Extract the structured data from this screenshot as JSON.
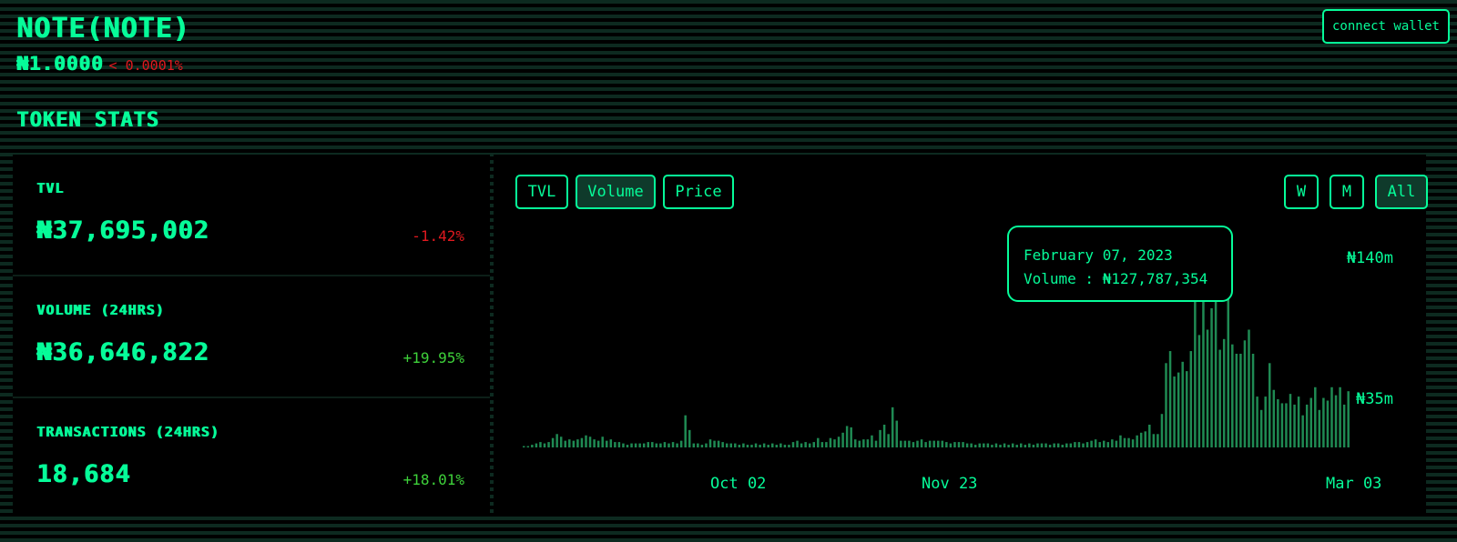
{
  "header": {
    "title": "NOTE(NOTE)",
    "price": "₦1.0000",
    "price_change": "< 0.0001%",
    "connect_label": "connect wallet"
  },
  "section_title": "TOKEN STATS",
  "stats": [
    {
      "label": "TVL",
      "value": "₦37,695,002",
      "change": "-1.42%"
    },
    {
      "label": "VOLUME (24HRS)",
      "value": "₦36,646,822",
      "change": "+19.95%"
    },
    {
      "label": "TRANSACTIONS (24HRS)",
      "value": "18,684",
      "change": "+18.01%"
    }
  ],
  "chart_controls": {
    "metric_tabs": [
      "TVL",
      "Volume",
      "Price"
    ],
    "active_metric": "Volume",
    "range_tabs": [
      "W",
      "M",
      "All"
    ],
    "active_range": "All"
  },
  "tooltip": {
    "date": "February 07, 2023",
    "value_line": "Volume : ₦127,787,354"
  },
  "colors": {
    "accent": "#06fc99",
    "bar": "#1f8a53",
    "negative": "#e0191f",
    "positive": "#3ed13a"
  },
  "chart_data": {
    "type": "bar",
    "series_name": "Volume",
    "y_ticks": [
      {
        "label": "₦140m",
        "value": 140
      },
      {
        "label": "₦35m",
        "value": 35
      }
    ],
    "x_ticks": [
      {
        "label": "Oct 02",
        "index": 47
      },
      {
        "label": "Nov 23",
        "index": 100
      },
      {
        "label": "Mar 03",
        "index": 208
      }
    ],
    "unit": "millions",
    "values": [
      1,
      1,
      2,
      3,
      4,
      3,
      4,
      7,
      10,
      8,
      5,
      6,
      5,
      6,
      7,
      9,
      8,
      6,
      5,
      8,
      5,
      6,
      4,
      4,
      3,
      2,
      3,
      3,
      3,
      3,
      4,
      4,
      3,
      3,
      4,
      3,
      4,
      3,
      5,
      24,
      13,
      3,
      3,
      2,
      3,
      6,
      5,
      5,
      4,
      3,
      3,
      3,
      2,
      3,
      2,
      2,
      3,
      2,
      3,
      2,
      3,
      2,
      3,
      2,
      2,
      4,
      5,
      3,
      4,
      3,
      4,
      7,
      4,
      4,
      7,
      6,
      8,
      11,
      16,
      15,
      6,
      5,
      6,
      6,
      9,
      5,
      13,
      17,
      10,
      30,
      20,
      5,
      5,
      5,
      4,
      5,
      6,
      4,
      5,
      5,
      5,
      5,
      4,
      3,
      4,
      4,
      4,
      3,
      3,
      2,
      3,
      3,
      3,
      2,
      3,
      2,
      3,
      2,
      3,
      2,
      3,
      2,
      3,
      2,
      3,
      3,
      3,
      2,
      3,
      3,
      2,
      3,
      3,
      4,
      4,
      3,
      4,
      5,
      6,
      4,
      5,
      4,
      6,
      5,
      9,
      7,
      7,
      6,
      9,
      11,
      12,
      17,
      10,
      10,
      25,
      63,
      72,
      53,
      56,
      64,
      57,
      72,
      146,
      84,
      115,
      88,
      104,
      127,
      73,
      81,
      112,
      77,
      70,
      70,
      80,
      88,
      70,
      38,
      28,
      38,
      63,
      43,
      36,
      33,
      33,
      40,
      32,
      38,
      24,
      32,
      37,
      45,
      28,
      37,
      35,
      45,
      39,
      45,
      32,
      42
    ],
    "highlight_index": 154
  }
}
